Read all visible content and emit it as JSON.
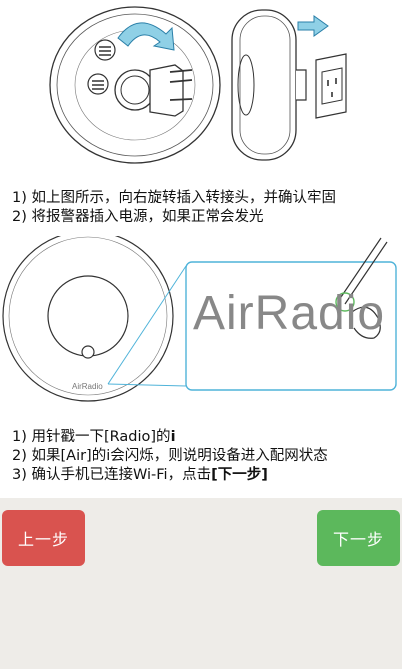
{
  "step1": {
    "lines": [
      "1) 如上图所示，向右旋转插入转接头，并确认牢固",
      "2) 将报警器插入电源，如果正常会发光"
    ]
  },
  "step2": {
    "device_label_small": "AirRadio",
    "device_label_large": "AirRadio",
    "lines_pre": [
      "1) 用针戳一下[Radio]的",
      "2) 如果[Air]的i会闪烁，则说明设备进入配网状态",
      "3) 确认手机已连接Wi-Fi，点击"
    ],
    "line1_bold": "i",
    "line3_bold": "[下一步]"
  },
  "buttons": {
    "prev_label": "上一步",
    "next_label": "下一步"
  },
  "colors": {
    "prev": "#d9534f",
    "next": "#5cb85c",
    "accent_blue": "#4fb3d9"
  }
}
